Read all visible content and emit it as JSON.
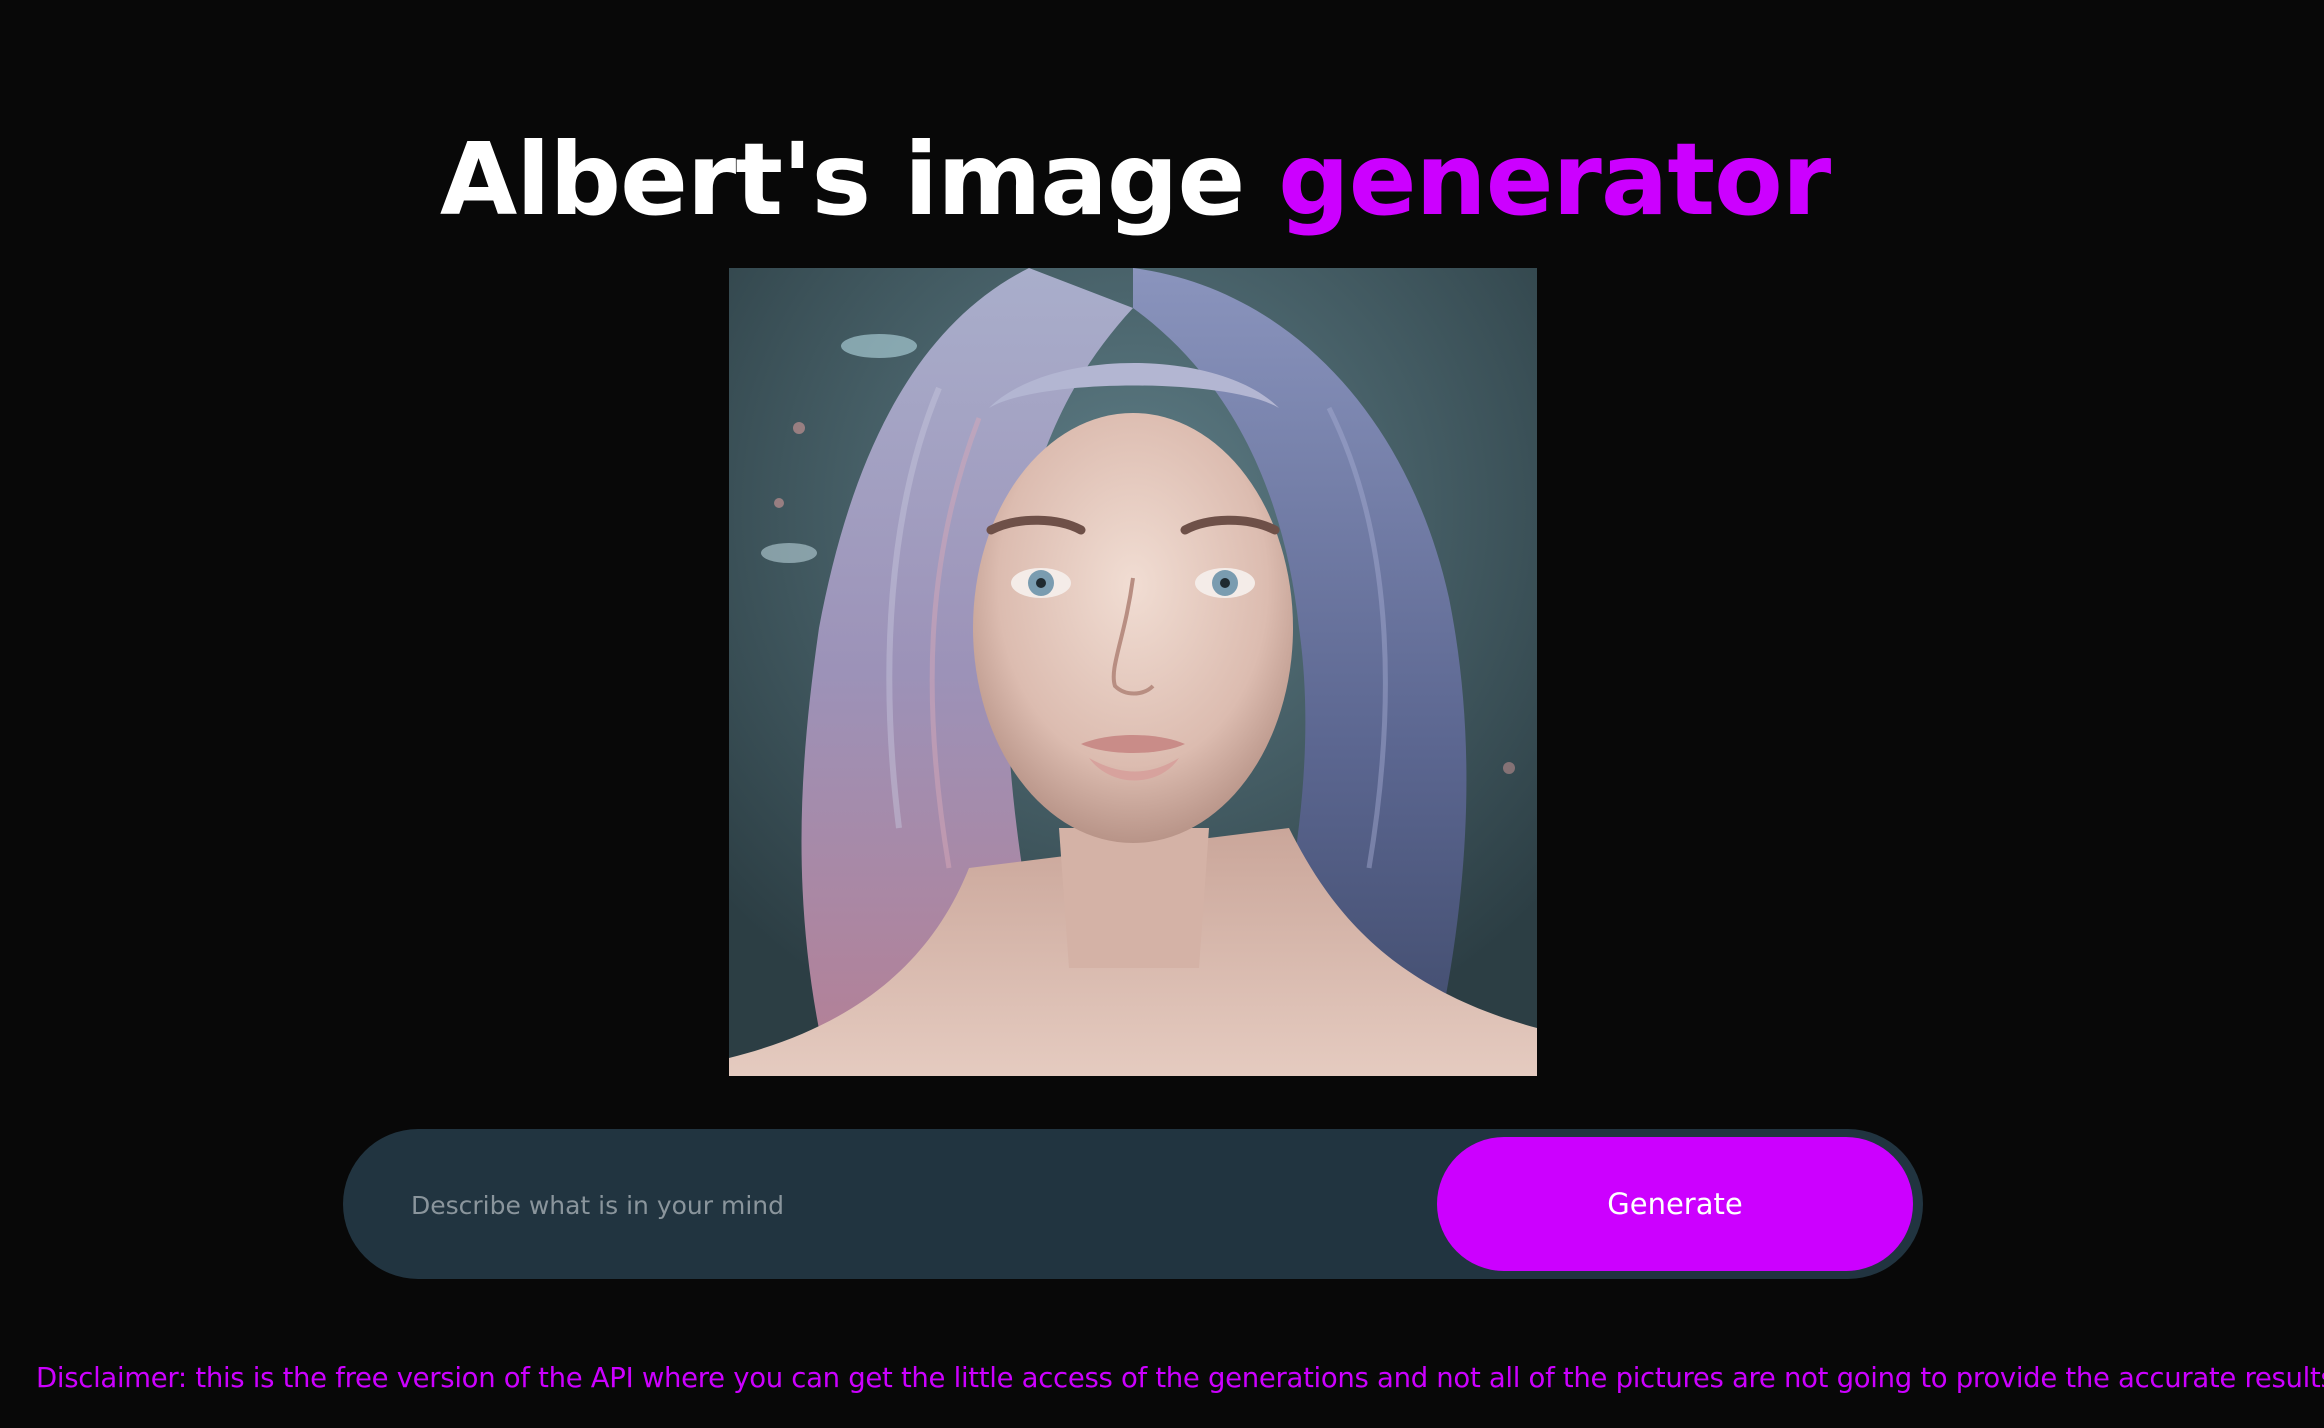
{
  "header": {
    "title_main": "Albert's image ",
    "title_accent": "generator"
  },
  "image": {
    "alt": "Generated portrait"
  },
  "prompt": {
    "placeholder": "Describe what is in your mind",
    "value": ""
  },
  "actions": {
    "generate_label": "Generate"
  },
  "footer": {
    "disclaimer": "Disclaimer: this is the free version of the API where you can get the little access of the generations and not all of the pictures are not going to provide the accurate results."
  },
  "colors": {
    "background": "#080808",
    "accent": "#cc00ff",
    "input_bg": "#213440",
    "title_text": "#ffffff"
  }
}
